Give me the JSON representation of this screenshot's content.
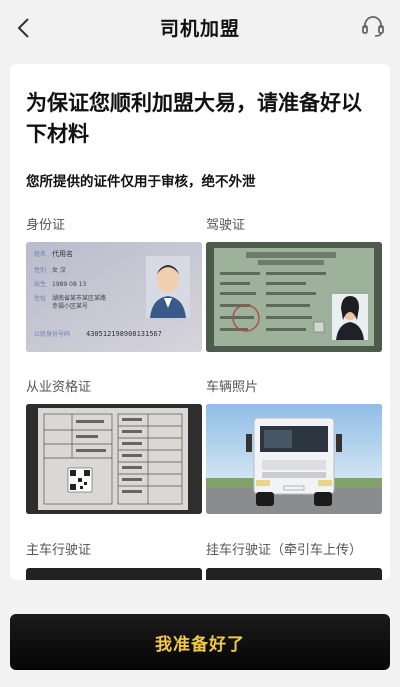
{
  "header": {
    "title": "司机加盟",
    "back_icon": "chevron-left-icon",
    "support_icon": "headset-icon"
  },
  "intro": {
    "headline": "为保证您顺利加盟大易，请准备好以下材料",
    "note": "您所提供的证件仅用于审核，绝不外泄"
  },
  "documents": [
    {
      "label": "身份证"
    },
    {
      "label": "驾驶证"
    },
    {
      "label": "从业资格证"
    },
    {
      "label": "车辆照片"
    },
    {
      "label": "主车行驶证"
    },
    {
      "label": "挂车行驶证（牵引车上传）"
    }
  ],
  "id_card": {
    "name": "代用名",
    "number": "430512198908131567"
  },
  "cta": {
    "label": "我准备好了"
  },
  "colors": {
    "accent": "#f3c74b",
    "button_bg": "#0b0b0b"
  }
}
